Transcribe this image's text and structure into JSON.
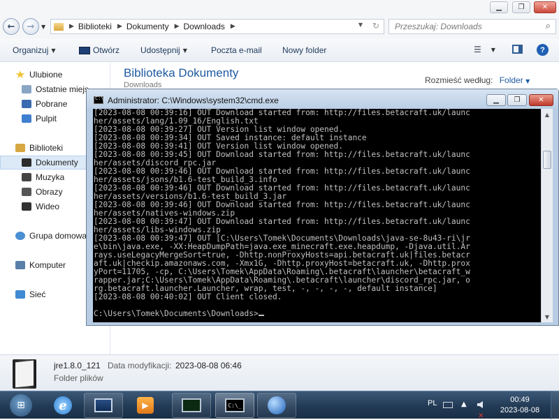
{
  "explorer": {
    "address": {
      "segments": [
        "Biblioteki",
        "Dokumenty",
        "Downloads"
      ]
    },
    "search_placeholder": "Przeszukaj: Downloads",
    "toolbar": {
      "organize": "Organizuj",
      "open": "Otwórz",
      "share": "Udostępnij",
      "email": "Poczta e-mail",
      "new_folder": "Nowy folder"
    },
    "nav": {
      "favorites": "Ulubione",
      "recent": "Ostatnie miejs",
      "downloads": "Pobrane",
      "desktop": "Pulpit",
      "libraries": "Biblioteki",
      "documents": "Dokumenty",
      "music": "Muzyka",
      "pictures": "Obrazy",
      "videos": "Wideo",
      "homegroup": "Grupa domowa",
      "computer": "Komputer",
      "network": "Sieć"
    },
    "content": {
      "title": "Biblioteka Dokumenty",
      "subtitle": "Downloads",
      "arrange_label": "Rozmieść według:",
      "arrange_value": "Folder"
    },
    "details": {
      "name": "jre1.8.0_121",
      "modified_label": "Data modyfikacji:",
      "modified_value": "2023-08-08 06:46",
      "type": "Folder plików"
    }
  },
  "cmd": {
    "title": "Administrator: C:\\Windows\\system32\\cmd.exe",
    "lines": [
      "[2023-08-08 00:39:16] OUT Download started from: http://files.betacraft.uk/launc",
      "her/assets/lang/1.09_16/English.txt",
      "[2023-08-08 00:39:27] OUT Version list window opened.",
      "[2023-08-08 00:39:34] OUT Saved instance: default instance",
      "[2023-08-08 00:39:41] OUT Version list window opened.",
      "[2023-08-08 00:39:45] OUT Download started from: http://files.betacraft.uk/launc",
      "her/assets/discord_rpc.jar",
      "[2023-08-08 00:39:46] OUT Download started from: http://files.betacraft.uk/launc",
      "her/assets/jsons/b1.6-test_build_3.info",
      "[2023-08-08 00:39:46] OUT Download started from: http://files.betacraft.uk/launc",
      "her/assets/versions/b1.6-test_build_3.jar",
      "[2023-08-08 00:39:46] OUT Download started from: http://files.betacraft.uk/launc",
      "her/assets/natives-windows.zip",
      "[2023-08-08 00:39:47] OUT Download started from: http://files.betacraft.uk/launc",
      "her/assets/libs-windows.zip",
      "[2023-08-08 00:39:47] OUT [C:\\Users\\Tomek\\Documents\\Downloads\\java-se-8u43-ri\\jr",
      "e\\bin\\java.exe, -XX:HeapDumpPath=java.exe_minecraft.exe.heapdump, -Djava.util.Ar",
      "rays.useLegacyMergeSort=true, -Dhttp.nonProxyHosts=api.betacraft.uk|files.betacr",
      "aft.uk|checkip.amazonaws.com, -Xmx1G, -Dhttp.proxyHost=betacraft.uk, -Dhttp.prox",
      "yPort=11705, -cp, C:\\Users\\Tomek\\AppData\\Roaming\\.betacraft\\launcher\\betacraft_w",
      "rapper.jar;C:\\Users\\Tomek\\AppData\\Roaming\\.betacraft\\launcher\\discord_rpc.jar, o",
      "rg.betacraft.launcher.Launcher, wrap, test, -, -, -, -, default instance]",
      "[2023-08-08 00:40:02] OUT Client closed.",
      "",
      "C:\\Users\\Tomek\\Documents\\Downloads>"
    ]
  },
  "taskbar": {
    "language": "PL",
    "time": "00:49",
    "date": "2023-08-08"
  }
}
